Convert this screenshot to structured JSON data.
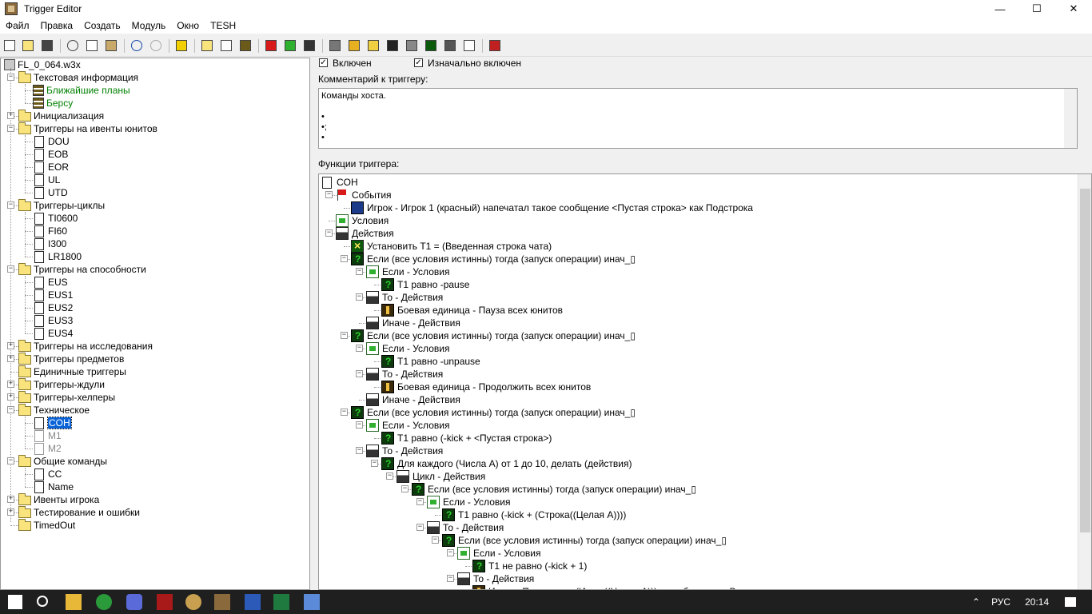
{
  "window": {
    "title": "Trigger Editor",
    "minimize": "—",
    "maximize": "☐",
    "close": "✕"
  },
  "menu": [
    "Файл",
    "Правка",
    "Создать",
    "Модуль",
    "Окно",
    "TESH"
  ],
  "tree": {
    "root": "FL_0_064.w3x",
    "nodes": [
      {
        "label": "Текстовая информация",
        "type": "folder",
        "level": 1,
        "expanded": true
      },
      {
        "label": "Ближайшие планы",
        "type": "comment",
        "level": 2,
        "style": "green"
      },
      {
        "label": "Берсу",
        "type": "comment",
        "level": 2,
        "style": "green"
      },
      {
        "label": "Инициализация",
        "type": "folder",
        "level": 1,
        "expanded": false
      },
      {
        "label": "Триггеры на ивенты юнитов",
        "type": "folder",
        "level": 1,
        "expanded": true
      },
      {
        "label": "DOU",
        "type": "doc",
        "level": 2
      },
      {
        "label": "EOB",
        "type": "doc",
        "level": 2
      },
      {
        "label": "EOR",
        "type": "doc",
        "level": 2
      },
      {
        "label": "UL",
        "type": "doc",
        "level": 2
      },
      {
        "label": "UTD",
        "type": "doc",
        "level": 2
      },
      {
        "label": "Триггеры-циклы",
        "type": "folder",
        "level": 1,
        "expanded": true
      },
      {
        "label": "TI0600",
        "type": "doc",
        "level": 2
      },
      {
        "label": "FI60",
        "type": "doc",
        "level": 2
      },
      {
        "label": "I300",
        "type": "doc",
        "level": 2
      },
      {
        "label": "LR1800",
        "type": "doc",
        "level": 2
      },
      {
        "label": "Триггеры на способности",
        "type": "folder",
        "level": 1,
        "expanded": true
      },
      {
        "label": "EUS",
        "type": "doc",
        "level": 2
      },
      {
        "label": "EUS1",
        "type": "doc",
        "level": 2
      },
      {
        "label": "EUS2",
        "type": "doc",
        "level": 2
      },
      {
        "label": "EUS3",
        "type": "doc",
        "level": 2
      },
      {
        "label": "EUS4",
        "type": "doc",
        "level": 2
      },
      {
        "label": "Триггеры на исследования",
        "type": "folder",
        "level": 1,
        "expanded": false
      },
      {
        "label": "Триггеры предметов",
        "type": "folder",
        "level": 1,
        "expanded": false
      },
      {
        "label": "Единичные триггеры",
        "type": "folder",
        "level": 1,
        "expanded": null
      },
      {
        "label": "Триггеры-ждули",
        "type": "folder",
        "level": 1,
        "expanded": false
      },
      {
        "label": "Триггеры-хелперы",
        "type": "folder",
        "level": 1,
        "expanded": false
      },
      {
        "label": "Техническое",
        "type": "folder",
        "level": 1,
        "expanded": true
      },
      {
        "label": "COH",
        "type": "doc",
        "level": 2,
        "style": "selected"
      },
      {
        "label": "M1",
        "type": "doc",
        "level": 2,
        "style": "disabled"
      },
      {
        "label": "M2",
        "type": "doc",
        "level": 2,
        "style": "disabled"
      },
      {
        "label": "Общие команды",
        "type": "folder",
        "level": 1,
        "expanded": true
      },
      {
        "label": "CC",
        "type": "doc",
        "level": 2
      },
      {
        "label": "Name",
        "type": "doc",
        "level": 2
      },
      {
        "label": "Ивенты игрока",
        "type": "folder",
        "level": 1,
        "expanded": false
      },
      {
        "label": "Тестирование и ошибки",
        "type": "folder",
        "level": 1,
        "expanded": false
      },
      {
        "label": "TimedOut",
        "type": "folder",
        "level": 1,
        "expanded": null
      }
    ]
  },
  "props": {
    "enabled_label": "Включен",
    "initially_enabled_label": "Изначально включен",
    "comment_label": "Комментарий к триггеру:",
    "comment_lines": [
      "Команды хоста.",
      "",
      "•",
      "•;",
      "•"
    ],
    "functions_label": "Функции триггера:"
  },
  "functions": [
    {
      "label": "COH",
      "icon": "doc",
      "level": 0
    },
    {
      "label": "События",
      "icon": "flag",
      "level": 1,
      "exp": "−"
    },
    {
      "label": "Игрок - Игрок 1 (красный) напечатал такое сообщение <Пустая строка> как Подстрока",
      "icon": "evt",
      "level": 2
    },
    {
      "label": "Условия",
      "icon": "cond",
      "level": 1
    },
    {
      "label": "Действия",
      "icon": "act",
      "level": 1,
      "exp": "−"
    },
    {
      "label": "Установить T1 = (Введенная строка чата)",
      "icon": "set",
      "level": 2
    },
    {
      "label": "Если (все условия истинны) тогда (запуск операции) инач_▯",
      "icon": "q",
      "level": 2,
      "exp": "−"
    },
    {
      "label": "Если - Условия",
      "icon": "cond",
      "level": 3,
      "exp": "−"
    },
    {
      "label": "T1 равно -pause",
      "icon": "q",
      "level": 4
    },
    {
      "label": "То - Действия",
      "icon": "act",
      "level": 3,
      "exp": "−"
    },
    {
      "label": "Боевая единица - Пауза всех юнитов",
      "icon": "unit",
      "level": 4
    },
    {
      "label": "Иначе - Действия",
      "icon": "act",
      "level": 3
    },
    {
      "label": "Если (все условия истинны) тогда (запуск операции) инач_▯",
      "icon": "q",
      "level": 2,
      "exp": "−"
    },
    {
      "label": "Если - Условия",
      "icon": "cond",
      "level": 3,
      "exp": "−"
    },
    {
      "label": "T1 равно -unpause",
      "icon": "q",
      "level": 4
    },
    {
      "label": "То - Действия",
      "icon": "act",
      "level": 3,
      "exp": "−"
    },
    {
      "label": "Боевая единица - Продолжить всех юнитов",
      "icon": "unit",
      "level": 4
    },
    {
      "label": "Иначе - Действия",
      "icon": "act",
      "level": 3
    },
    {
      "label": "Если (все условия истинны) тогда (запуск операции) инач_▯",
      "icon": "q",
      "level": 2,
      "exp": "−"
    },
    {
      "label": "Если - Условия",
      "icon": "cond",
      "level": 3,
      "exp": "−"
    },
    {
      "label": "T1 равно (-kick + <Пустая строка>)",
      "icon": "q",
      "level": 4
    },
    {
      "label": "То - Действия",
      "icon": "act",
      "level": 3,
      "exp": "−"
    },
    {
      "label": "Для каждого (Числа А) от 1 до 10, делать (действия)",
      "icon": "q",
      "level": 4,
      "exp": "−"
    },
    {
      "label": "Цикл - Действия",
      "icon": "act",
      "level": 5,
      "exp": "−"
    },
    {
      "label": "Если (все условия истинны) тогда (запуск операции) инач_▯",
      "icon": "q",
      "level": 6,
      "exp": "−"
    },
    {
      "label": "Если - Условия",
      "icon": "cond",
      "level": 7,
      "exp": "−"
    },
    {
      "label": "T1 равно (-kick + (Строка((Целая А))))",
      "icon": "q",
      "level": 8
    },
    {
      "label": "То - Действия",
      "icon": "act",
      "level": 7,
      "exp": "−"
    },
    {
      "label": "Если (все условия истинны) тогда (запуск операции) инач_▯",
      "icon": "q",
      "level": 8,
      "exp": "−"
    },
    {
      "label": "Если - Условия",
      "icon": "cond",
      "level": 9,
      "exp": "−"
    },
    {
      "label": "T1 не равно (-kick + 1)",
      "icon": "q",
      "level": 10
    },
    {
      "label": "То - Действия",
      "icon": "act",
      "level": 9,
      "exp": "−"
    },
    {
      "label": "Игрок - Поражение (Игрок((Целая А))) с сообщением: Вы проиграли",
      "icon": "unit",
      "level": 10
    }
  ],
  "taskbar": {
    "lang": "РУС",
    "time": "20:14"
  }
}
